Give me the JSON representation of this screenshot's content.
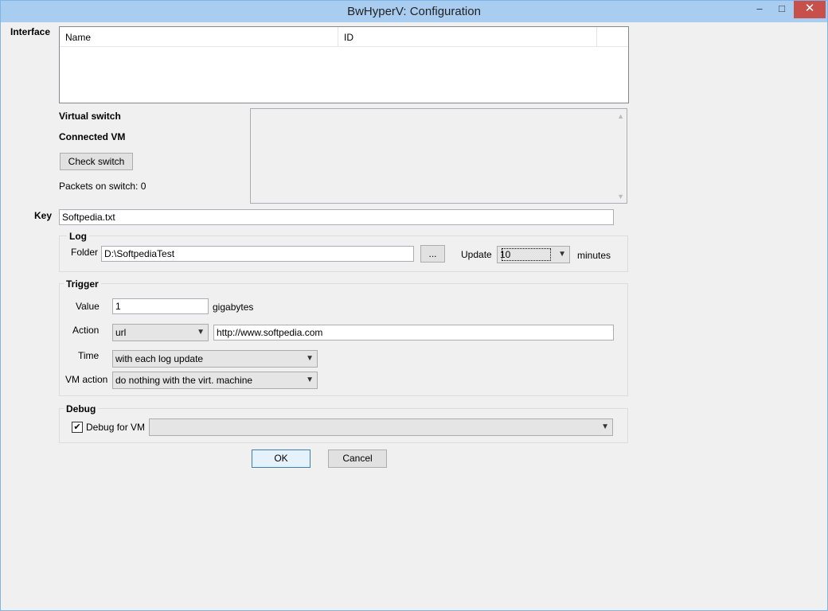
{
  "window": {
    "title": "BwHyperV: Configuration",
    "minimize": "–",
    "maximize": "□",
    "close": "✕"
  },
  "interface": {
    "label": "Interface",
    "columns": [
      "Name",
      "ID"
    ]
  },
  "switch": {
    "virtual_switch_label": "Virtual switch",
    "connected_vm_label": "Connected VM",
    "check_button": "Check switch",
    "packets_text": "Packets on switch: 0"
  },
  "key": {
    "label": "Key",
    "value": "Softpedia.txt"
  },
  "log": {
    "group_label": "Log",
    "folder_label": "Folder",
    "folder_value": "D:\\SoftpediaTest",
    "browse_button": "...",
    "update_label": "Update",
    "update_value": "10",
    "minutes_label": "minutes"
  },
  "trigger": {
    "group_label": "Trigger",
    "value_label": "Value",
    "value": "1",
    "unit": "gigabytes",
    "action_label": "Action",
    "action_value": "url",
    "action_target": "http://www.softpedia.com",
    "time_label": "Time",
    "time_value": "with each log update",
    "vm_action_label": "VM action",
    "vm_action_value": "do nothing with the virt. machine"
  },
  "debug": {
    "group_label": "Debug",
    "checkbox_label": "Debug for VM",
    "checked": true,
    "vm_value": ""
  },
  "buttons": {
    "ok": "OK",
    "cancel": "Cancel"
  }
}
